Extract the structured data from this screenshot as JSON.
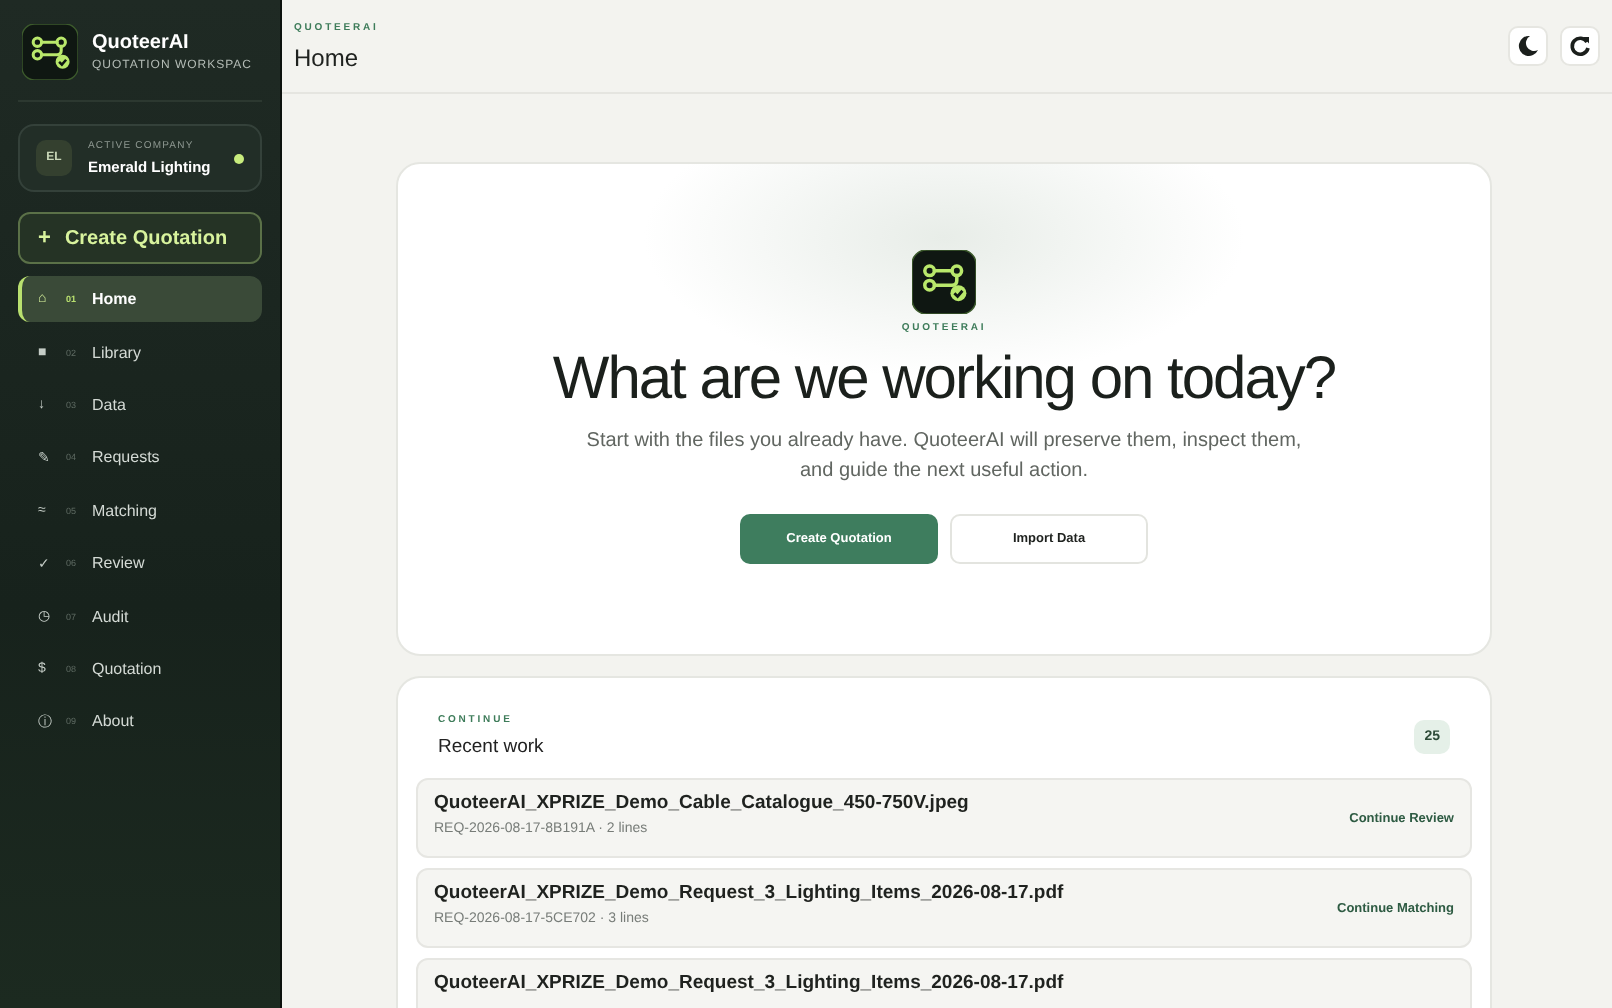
{
  "brand": {
    "name": "QuoteerAI",
    "subtitle": "QUOTATION WORKSPAC"
  },
  "company": {
    "initials": "EL",
    "label": "ACTIVE COMPANY",
    "name": "Emerald Lighting",
    "online": true
  },
  "create_button": {
    "icon": "+",
    "label": "Create Quotation"
  },
  "nav": [
    {
      "icon": "⌂",
      "number": "01",
      "label": "Home",
      "selected": true
    },
    {
      "icon": "■",
      "number": "02",
      "label": "Library",
      "selected": false
    },
    {
      "icon": "↓",
      "number": "03",
      "label": "Data",
      "selected": false
    },
    {
      "icon": "✎",
      "number": "04",
      "label": "Requests",
      "selected": false
    },
    {
      "icon": "≈",
      "number": "05",
      "label": "Matching",
      "selected": false
    },
    {
      "icon": "✓",
      "number": "06",
      "label": "Review",
      "selected": false
    },
    {
      "icon": "◷",
      "number": "07",
      "label": "Audit",
      "selected": false
    },
    {
      "icon": "$",
      "number": "08",
      "label": "Quotation",
      "selected": false
    },
    {
      "icon": "ⓘ",
      "number": "09",
      "label": "About",
      "selected": false
    }
  ],
  "header": {
    "eyebrow": "QUOTEERAI",
    "title": "Home"
  },
  "hero": {
    "eyebrow": "QUOTEERAI",
    "heading": "What are we working on today?",
    "text": "Start with the files you already have. QuoteerAI will preserve them, inspect them, and guide the next useful action.",
    "primary": "Create Quotation",
    "secondary": "Import Data"
  },
  "recent": {
    "eyebrow": "CONTINUE",
    "title": "Recent work",
    "count": "25",
    "items": [
      {
        "title": "QuoteerAI_XPRIZE_Demo_Cable_Catalogue_450-750V.jpeg",
        "meta": "REQ-2026-08-17-8B191A · 2 lines",
        "action": "Continue Review"
      },
      {
        "title": "QuoteerAI_XPRIZE_Demo_Request_3_Lighting_Items_2026-08-17.pdf",
        "meta": "REQ-2026-08-17-5CE702 · 3 lines",
        "action": "Continue Matching"
      },
      {
        "title": "QuoteerAI_XPRIZE_Demo_Request_3_Lighting_Items_2026-08-17.pdf"
      }
    ]
  }
}
